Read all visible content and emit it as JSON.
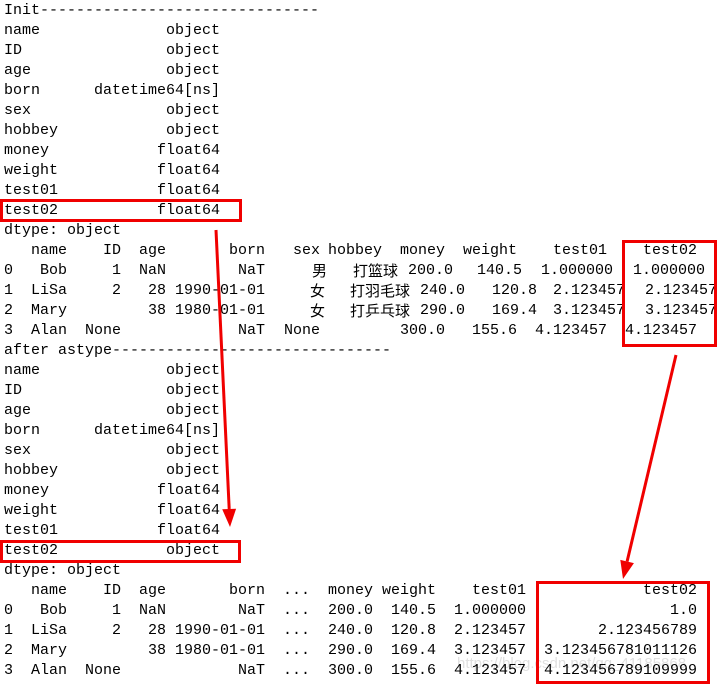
{
  "init_section": {
    "label": "Init-------------------------------",
    "dtypes": [
      {
        "column": "name",
        "dtype": "object"
      },
      {
        "column": "ID",
        "dtype": "object"
      },
      {
        "column": "age",
        "dtype": "object"
      },
      {
        "column": "born",
        "dtype": "datetime64[ns]"
      },
      {
        "column": "sex",
        "dtype": "object"
      },
      {
        "column": "hobbey",
        "dtype": "object"
      },
      {
        "column": "money",
        "dtype": "float64"
      },
      {
        "column": "weight",
        "dtype": "float64"
      },
      {
        "column": "test01",
        "dtype": "float64"
      },
      {
        "column": "test02",
        "dtype": "float64"
      }
    ],
    "dtype_footer": "dtype: object",
    "table": {
      "columns": [
        "name",
        "ID",
        "age",
        "born",
        "sex",
        "hobbey",
        "money",
        "weight",
        "test01",
        "test02"
      ],
      "rows": [
        {
          "index": "0",
          "cells": [
            "Bob",
            "1",
            "NaN",
            "NaT",
            "男",
            "打篮球",
            "200.0",
            "140.5",
            "1.000000",
            "1.000000"
          ]
        },
        {
          "index": "1",
          "cells": [
            "LiSa",
            "2",
            "28",
            "1990-01-01",
            "女",
            "打羽毛球",
            "240.0",
            "120.8",
            "2.123457",
            "2.123457"
          ]
        },
        {
          "index": "2",
          "cells": [
            "Mary",
            "",
            "38",
            "1980-01-01",
            "女",
            "打乒乓球",
            "290.0",
            "169.4",
            "3.123457",
            "3.123457"
          ]
        },
        {
          "index": "3",
          "cells": [
            "Alan",
            "None",
            "",
            "NaT",
            "None",
            "",
            "300.0",
            "155.6",
            "4.123457",
            "4.123457"
          ]
        }
      ]
    }
  },
  "after_section": {
    "label": "after astype-------------------------------",
    "dtypes": [
      {
        "column": "name",
        "dtype": "object"
      },
      {
        "column": "ID",
        "dtype": "object"
      },
      {
        "column": "age",
        "dtype": "object"
      },
      {
        "column": "born",
        "dtype": "datetime64[ns]"
      },
      {
        "column": "sex",
        "dtype": "object"
      },
      {
        "column": "hobbey",
        "dtype": "object"
      },
      {
        "column": "money",
        "dtype": "float64"
      },
      {
        "column": "weight",
        "dtype": "float64"
      },
      {
        "column": "test01",
        "dtype": "float64"
      },
      {
        "column": "test02",
        "dtype": "object"
      }
    ],
    "dtype_footer": "dtype: object",
    "table": {
      "columns": [
        "name",
        "ID",
        "age",
        "born",
        "...",
        "money",
        "weight",
        "test01",
        "test02"
      ],
      "rows": [
        {
          "index": "0",
          "cells": [
            "Bob",
            "1",
            "NaN",
            "NaT",
            "...",
            "200.0",
            "140.5",
            "1.000000",
            "1.0"
          ]
        },
        {
          "index": "1",
          "cells": [
            "LiSa",
            "2",
            "28",
            "1990-01-01",
            "...",
            "240.0",
            "120.8",
            "2.123457",
            "2.123456789"
          ]
        },
        {
          "index": "2",
          "cells": [
            "Mary",
            "",
            "38",
            "1980-01-01",
            "...",
            "290.0",
            "169.4",
            "3.123457",
            "3.123456781011126"
          ]
        },
        {
          "index": "3",
          "cells": [
            "Alan",
            "None",
            "",
            "NaT",
            "...",
            "300.0",
            "155.6",
            "4.123457",
            "4.123456789109999"
          ]
        }
      ]
    }
  },
  "annotations": {
    "highlight_color": "#f00000",
    "highlights": [
      "test02 dtype before astype (float64)",
      "test02 values before astype",
      "test02 dtype after astype (object)",
      "test02 values after astype"
    ],
    "arrows": [
      "from test02 float64 dtype to test02 object dtype",
      "from test02 values before to test02 values after"
    ]
  },
  "watermark": "https://blog.csdn.net/qq_41185868"
}
